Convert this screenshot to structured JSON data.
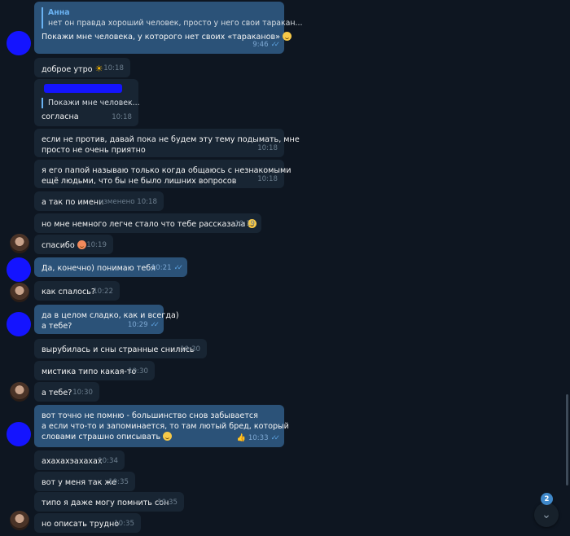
{
  "messages": [
    {
      "id": "m1",
      "dir": "out",
      "reply_name": "Анна",
      "reply_text": "нет он правда хороший человек, просто у него свои таракан...",
      "lines": [
        "Покажи мне человека, у которого нет своих «тараканов»"
      ],
      "time": "9:46",
      "emoji": "grin"
    },
    {
      "id": "m2",
      "dir": "in",
      "lines": [
        "доброе утро"
      ],
      "time": "10:18",
      "emoji": "sun"
    },
    {
      "id": "m3",
      "dir": "in",
      "reply_text": "Покажи мне человек...",
      "lines": [
        "согласна"
      ],
      "time": "10:18"
    },
    {
      "id": "m4",
      "dir": "in",
      "lines": [
        "если не против, давай пока не будем эту тему подымать, мне",
        "просто не очень приятно"
      ],
      "time": "10:18"
    },
    {
      "id": "m5",
      "dir": "in",
      "lines": [
        "я его папой называю только когда общаюсь с незнакомыми",
        "ещё людьми, что бы не было лишних вопросов"
      ],
      "time": "10:18"
    },
    {
      "id": "m6",
      "dir": "in",
      "lines": [
        "а так по имени"
      ],
      "time": "изменено 10:18"
    },
    {
      "id": "m7",
      "dir": "in",
      "lines": [
        "но мне немного легче стало что тебе рассказала"
      ],
      "time": "10:19",
      "emoji": "grin"
    },
    {
      "id": "m8",
      "dir": "in",
      "lines": [
        "спасибо"
      ],
      "time": "10:19",
      "emoji": "heart"
    },
    {
      "id": "m9",
      "dir": "out",
      "lines": [
        "Да, конечно) понимаю тебя"
      ],
      "time": "10:21"
    },
    {
      "id": "m10",
      "dir": "in",
      "lines": [
        "как спалось?"
      ],
      "time": "10:22"
    },
    {
      "id": "m11",
      "dir": "out",
      "lines": [
        "да в целом сладко, как и всегда)",
        "а тебе?"
      ],
      "time": "10:29"
    },
    {
      "id": "m12",
      "dir": "in",
      "lines": [
        "вырубилась и сны странные снились"
      ],
      "time": "10:30"
    },
    {
      "id": "m13",
      "dir": "in",
      "lines": [
        "мистика типо какая-то"
      ],
      "time": "10:30"
    },
    {
      "id": "m14",
      "dir": "in",
      "lines": [
        "а тебе?"
      ],
      "time": "10:30"
    },
    {
      "id": "m15",
      "dir": "out",
      "lines": [
        "вот точно не помню - большинство снов забывается",
        "а если что-то и запоминается, то там лютый бред, который",
        "словами страшно описывать"
      ],
      "time": "10:33",
      "emoji": "laugh",
      "reaction": "👍"
    },
    {
      "id": "m16",
      "dir": "in",
      "lines": [
        "ахахахэахахах"
      ],
      "time": "10:34"
    },
    {
      "id": "m17",
      "dir": "in",
      "lines": [
        "вот у меня так же"
      ],
      "time": "10:35"
    },
    {
      "id": "m18",
      "dir": "in",
      "lines": [
        "типо я даже могу помнить сон"
      ],
      "time": "10:35"
    },
    {
      "id": "m19",
      "dir": "in",
      "lines": [
        "но описать трудно"
      ],
      "time": "10:35"
    }
  ],
  "unread_badge": "2",
  "scroll_down_icon": "chevron-down-icon",
  "colors": {
    "background": "#0e1621",
    "incoming_bubble": "#182533",
    "outgoing_bubble": "#2b5278",
    "accent": "#6ab2f2",
    "badge": "#3f88c9"
  }
}
